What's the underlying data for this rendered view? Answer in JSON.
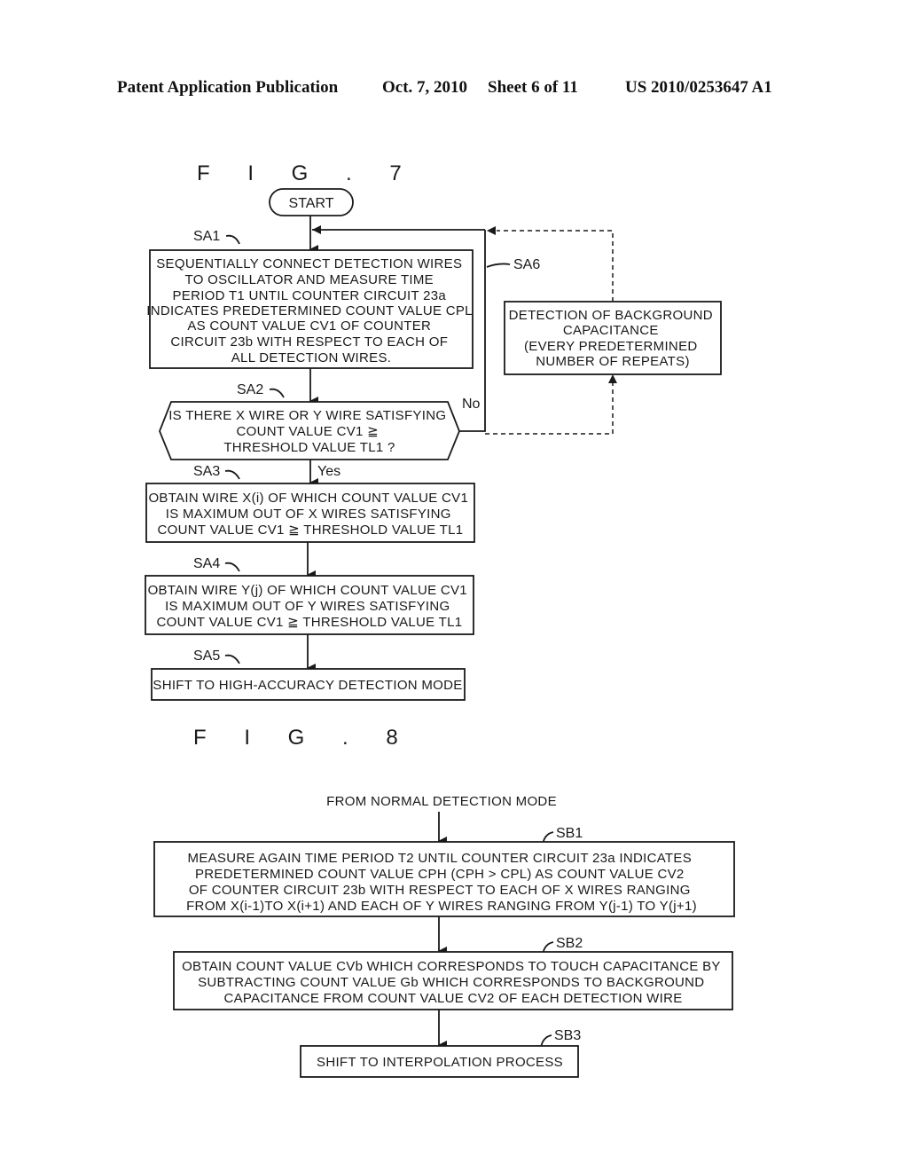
{
  "header": {
    "publication": "Patent Application Publication",
    "date": "Oct. 7, 2010",
    "sheet": "Sheet 6 of 11",
    "number": "US 2010/0253647 A1"
  },
  "fig7": {
    "title": "F I G . 7",
    "start": "START",
    "steps": {
      "SA1": {
        "label": "SA1",
        "lines": [
          "SEQUENTIALLY CONNECT DETECTION WIRES",
          "TO OSCILLATOR AND MEASURE TIME",
          "PERIOD T1 UNTIL COUNTER CIRCUIT 23a",
          "INDICATES PREDETERMINED COUNT VALUE CPL",
          "AS COUNT VALUE CV1 OF COUNTER",
          "CIRCUIT 23b WITH RESPECT TO EACH OF",
          "ALL DETECTION WIRES."
        ]
      },
      "SA2": {
        "label": "SA2",
        "lines": [
          "IS THERE X WIRE OR Y WIRE SATISFYING",
          "COUNT VALUE CV1 ≧",
          "THRESHOLD VALUE TL1 ?"
        ],
        "yes": "Yes",
        "no": "No"
      },
      "SA3": {
        "label": "SA3",
        "lines": [
          "OBTAIN WIRE X(i) OF WHICH COUNT VALUE CV1",
          "IS MAXIMUM OUT OF X WIRES SATISFYING",
          "COUNT VALUE CV1 ≧ THRESHOLD VALUE TL1"
        ]
      },
      "SA4": {
        "label": "SA4",
        "lines": [
          "OBTAIN WIRE Y(j) OF WHICH COUNT VALUE CV1",
          "IS MAXIMUM OUT OF Y WIRES SATISFYING",
          "COUNT VALUE CV1 ≧ THRESHOLD VALUE TL1"
        ]
      },
      "SA5": {
        "label": "SA5",
        "lines": [
          "SHIFT TO HIGH-ACCURACY DETECTION MODE"
        ]
      },
      "SA6": {
        "label": "SA6",
        "lines": [
          "DETECTION OF BACKGROUND",
          "CAPACITANCE",
          "(EVERY PREDETERMINED",
          "NUMBER OF REPEATS)"
        ]
      }
    }
  },
  "fig8": {
    "title": "F I G . 8",
    "entry": "FROM NORMAL DETECTION MODE",
    "steps": {
      "SB1": {
        "label": "SB1",
        "lines": [
          "MEASURE AGAIN TIME PERIOD T2 UNTIL COUNTER CIRCUIT 23a INDICATES",
          "PREDETERMINED COUNT VALUE CPH (CPH > CPL) AS COUNT VALUE CV2",
          "OF COUNTER CIRCUIT 23b WITH RESPECT TO EACH OF X WIRES RANGING",
          "FROM X(i-1)TO X(i+1) AND EACH OF Y WIRES RANGING FROM Y(j-1) TO Y(j+1)"
        ]
      },
      "SB2": {
        "label": "SB2",
        "lines": [
          "OBTAIN COUNT VALUE CVb WHICH CORRESPONDS TO TOUCH CAPACITANCE BY",
          "SUBTRACTING COUNT VALUE Gb WHICH CORRESPONDS TO BACKGROUND",
          "CAPACITANCE FROM COUNT VALUE CV2 OF EACH DETECTION WIRE"
        ]
      },
      "SB3": {
        "label": "SB3",
        "lines": [
          "SHIFT TO INTERPOLATION PROCESS"
        ]
      }
    }
  }
}
